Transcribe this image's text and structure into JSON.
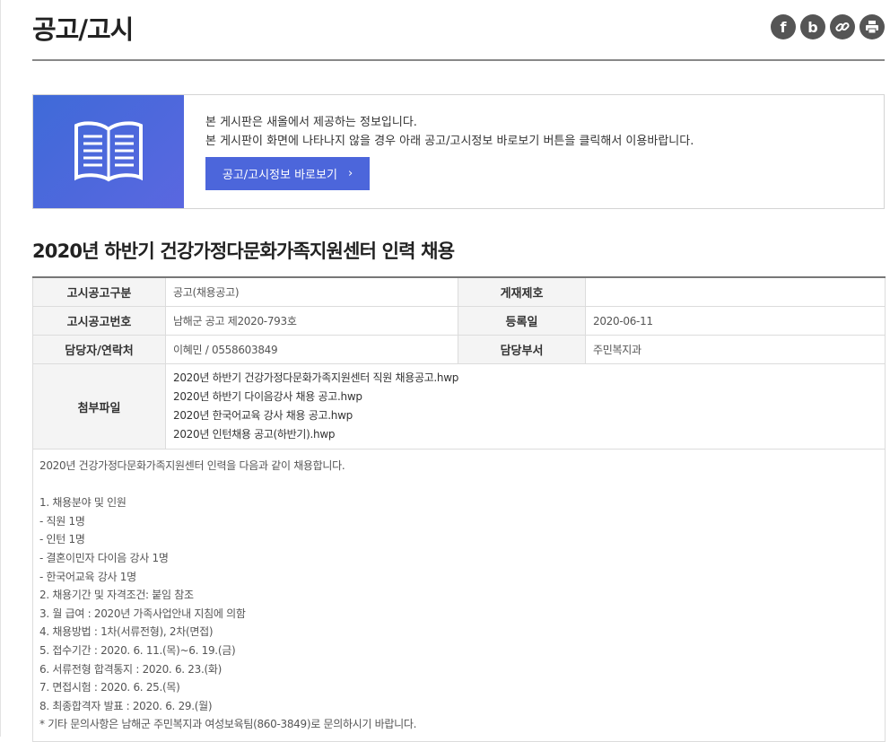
{
  "page_title": "공고/고시",
  "share_icons": [
    "facebook-icon",
    "blog-icon",
    "link-icon",
    "print-icon"
  ],
  "notice": {
    "line1": "본 게시판은 새올에서 제공하는 정보입니다.",
    "line2": "본 게시판이 화면에 나타나지 않을 경우 아래 공고/고시정보 바로보기 버튼을 클릭해서 이용바랍니다.",
    "button_label": "공고/고시정보 바로보기",
    "button_arrow": "›"
  },
  "post": {
    "title": "2020년 하반기 건강가정다문화가족지원센터 인력 채용",
    "rows": {
      "category_label": "고시공고구분",
      "category_value": "공고(채용공고)",
      "posting_no_label": "게재제호",
      "posting_no_value": "",
      "notice_no_label": "고시공고번호",
      "notice_no_value": "남해군 공고 제2020-793호",
      "reg_date_label": "등록일",
      "reg_date_value": "2020-06-11",
      "contact_label": "담당자/연락처",
      "contact_value": "이혜민 / 0558603849",
      "dept_label": "담당부서",
      "dept_value": "주민복지과",
      "files_label": "첨부파일"
    },
    "files": [
      "2020년 하반기 건강가정다문화가족지원센터 직원 채용공고.hwp",
      "2020년 하반기 다이음강사 채용 공고.hwp",
      "2020년 한국어교육 강사 채용 공고.hwp",
      "2020년 인턴채용 공고(하반기).hwp"
    ],
    "body": [
      "2020년 건강가정다문화가족지원센터 인력을 다음과 같이 채용합니다.",
      "",
      "1. 채용분야 및 인원",
      "- 직원 1명",
      "- 인턴 1명",
      "- 결혼이민자 다이음 강사 1명",
      "- 한국어교육 강사 1명",
      "2. 채용기간 및 자격조건: 붙임 참조",
      "3. 월 급여 : 2020년 가족사업안내 지침에 의함",
      "4. 채용방법 : 1차(서류전형), 2차(면접)",
      "5. 접수기간 : 2020. 6. 11.(목)~6. 19.(금)",
      "6. 서류전형 합격통지 : 2020. 6. 23.(화)",
      "7. 면접시험 : 2020. 6. 25.(목)",
      "8. 최종합격자 발표 : 2020. 6. 29.(월)",
      "* 기타 문의사항은 남해군 주민복지과 여성보육팀(860-3849)로 문의하시기 바랍니다."
    ]
  }
}
